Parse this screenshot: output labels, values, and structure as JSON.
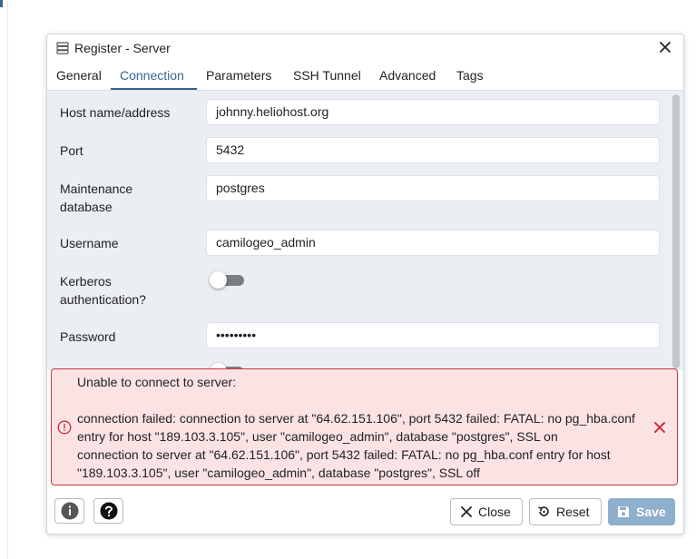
{
  "dialog": {
    "title": "Register - Server",
    "title_icon": "server-icon",
    "close_icon": "close-icon"
  },
  "tabs": [
    {
      "label": "General",
      "active": false
    },
    {
      "label": "Connection",
      "active": true
    },
    {
      "label": "Parameters",
      "active": false
    },
    {
      "label": "SSH Tunnel",
      "active": false
    },
    {
      "label": "Advanced",
      "active": false
    },
    {
      "label": "Tags",
      "active": false
    }
  ],
  "form": {
    "host": {
      "label": "Host name/address",
      "value": "johnny.heliohost.org"
    },
    "port": {
      "label": "Port",
      "value": "5432"
    },
    "maintenance_db": {
      "label_line1": "Maintenance",
      "label_line2": "database",
      "value": "postgres"
    },
    "username": {
      "label": "Username",
      "value": "camilogeo_admin"
    },
    "kerberos": {
      "label_line1": "Kerberos",
      "label_line2": "authentication?",
      "enabled": false
    },
    "password": {
      "label": "Password",
      "value": "•••••••••"
    }
  },
  "error": {
    "line1": "Unable to connect to server:",
    "line2": "connection failed: connection to server at \"64.62.151.106\", port 5432 failed: FATAL: no pg_hba.conf",
    "line3": "entry for host \"189.103.3.105\", user \"camilogeo_admin\", database \"postgres\", SSL on",
    "line4": "connection to server at \"64.62.151.106\", port 5432 failed: FATAL: no pg_hba.conf entry for host",
    "line5": "\"189.103.3.105\", user \"camilogeo_admin\", database \"postgres\", SSL off",
    "icon": "error-circle-icon"
  },
  "footer": {
    "info_icon": "info-icon",
    "help_icon": "help-icon",
    "close_label": "Close",
    "reset_label": "Reset",
    "save_label": "Save"
  },
  "colors": {
    "accent": "#326690",
    "form_bg": "#ebeef3",
    "error_bg": "#fbe3e4",
    "error_border": "#c9363e",
    "save_bg": "#8fb0cc"
  }
}
